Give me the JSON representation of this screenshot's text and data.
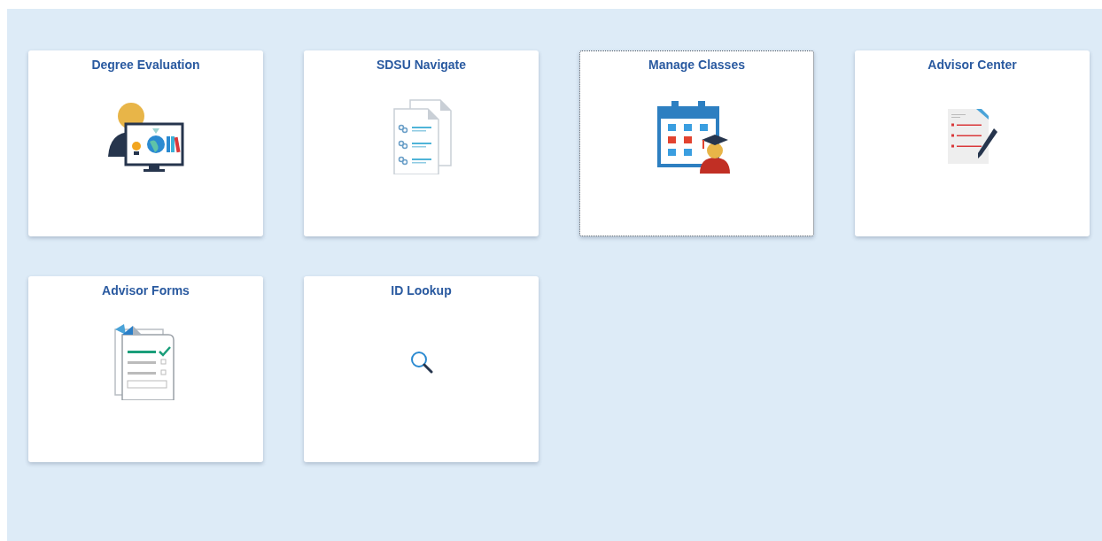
{
  "tiles": [
    {
      "title": "Degree Evaluation",
      "kind": "evaluation",
      "focused": false
    },
    {
      "title": "SDSU Navigate",
      "kind": "links",
      "focused": false
    },
    {
      "title": "Manage Classes",
      "kind": "calendar",
      "focused": true
    },
    {
      "title": "Advisor Center",
      "kind": "notes",
      "focused": false
    },
    {
      "title": "Advisor Forms",
      "kind": "forms",
      "focused": false
    },
    {
      "title": "ID Lookup",
      "kind": "search",
      "focused": false
    }
  ]
}
